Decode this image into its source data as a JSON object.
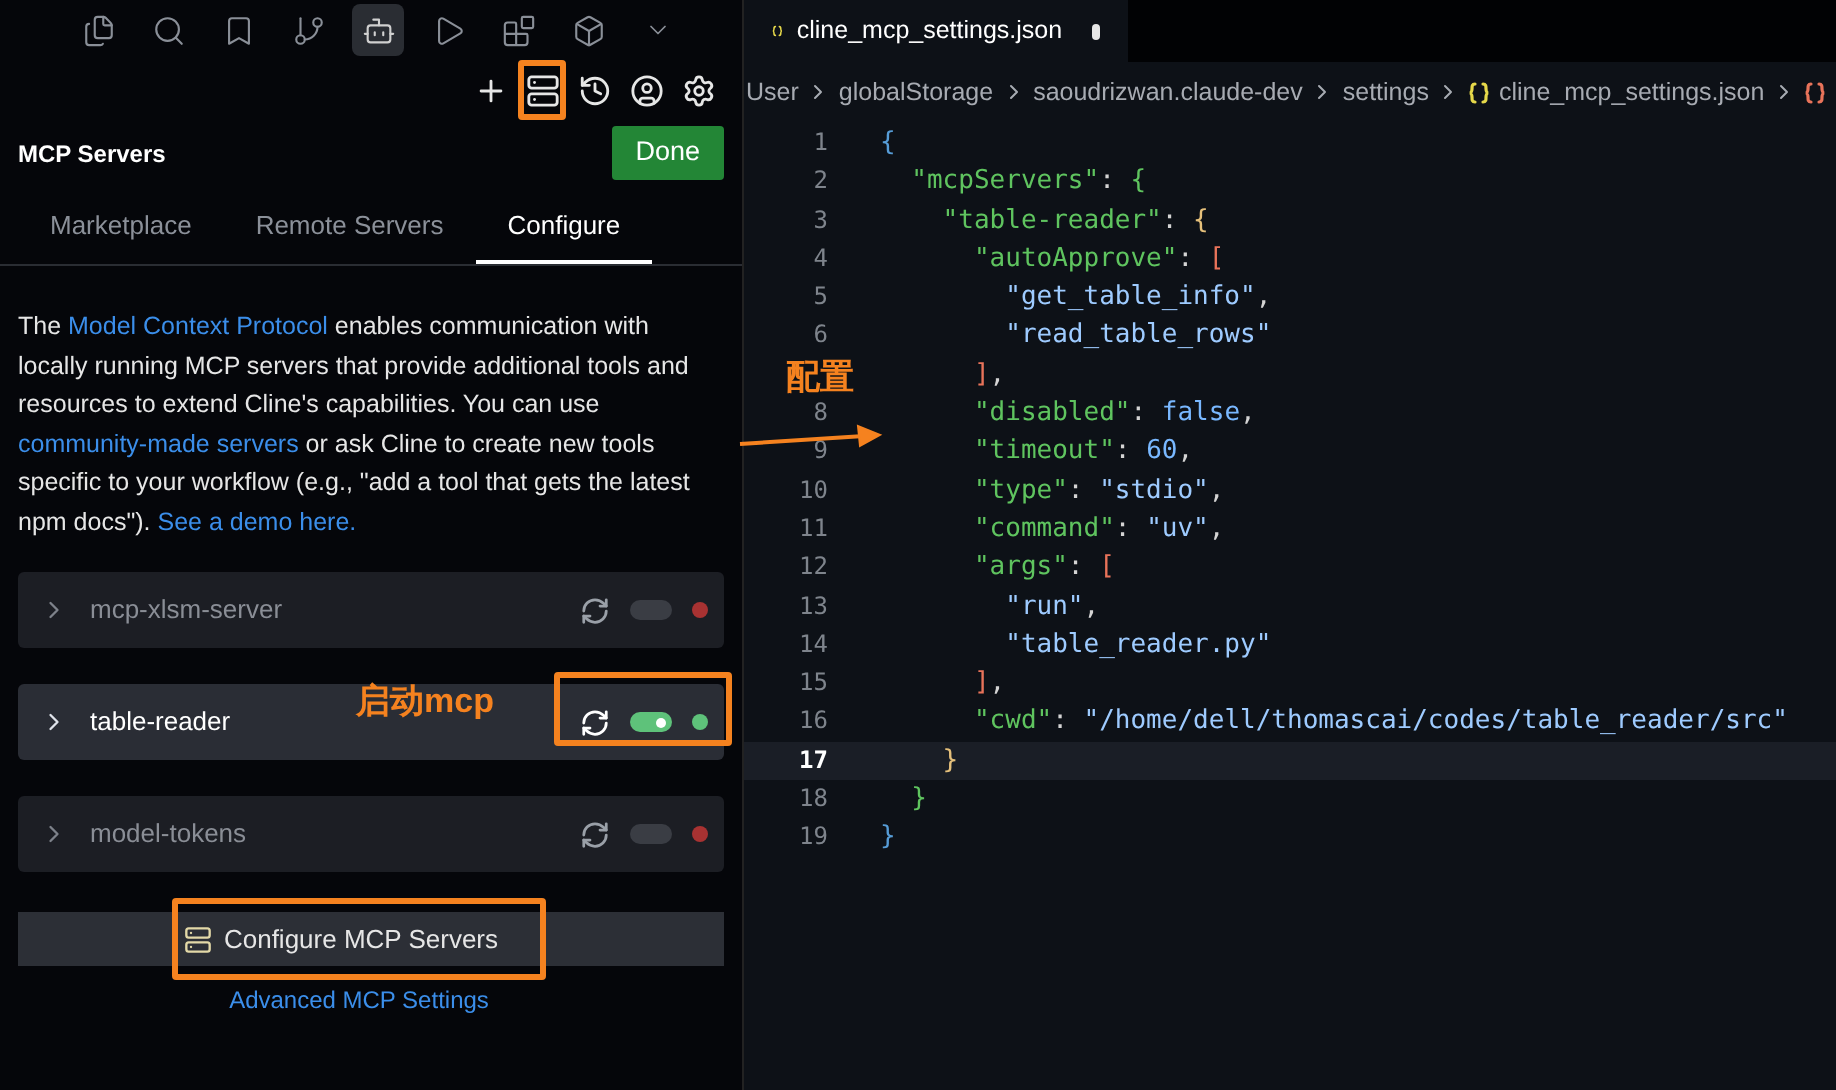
{
  "activity_bar": [
    {
      "kind": "files",
      "selected": false
    },
    {
      "kind": "search",
      "selected": false
    },
    {
      "kind": "bookmark",
      "selected": false
    },
    {
      "kind": "branch",
      "selected": false
    },
    {
      "kind": "robot",
      "selected": true
    },
    {
      "kind": "run",
      "selected": false
    },
    {
      "kind": "blocks",
      "selected": false
    },
    {
      "kind": "cube",
      "selected": false
    },
    {
      "kind": "more",
      "selected": false
    }
  ],
  "toolbar": [
    {
      "kind": "plus",
      "highlighted": false
    },
    {
      "kind": "servers",
      "highlighted": true
    },
    {
      "kind": "history",
      "highlighted": false
    },
    {
      "kind": "account",
      "highlighted": false
    },
    {
      "kind": "settings",
      "highlighted": false
    }
  ],
  "header": {
    "title": "MCP Servers",
    "done_button": "Done"
  },
  "tabs": [
    {
      "label": "Marketplace",
      "selected": false
    },
    {
      "label": "Remote Servers",
      "selected": false
    },
    {
      "label": "Configure",
      "selected": true
    }
  ],
  "description": [
    {
      "text": "The ",
      "link": false
    },
    {
      "text": "Model Context Protocol",
      "link": true
    },
    {
      "text": " enables communication with locally running MCP servers that provide additional tools and resources to extend Cline's capabilities. You can use ",
      "link": false
    },
    {
      "text": "community-made servers",
      "link": true
    },
    {
      "text": " or ask Cline to create new tools specific to your workflow (e.g., \"add a tool that gets the latest npm docs\"). ",
      "link": false
    },
    {
      "text": "See a demo here.",
      "link": true
    }
  ],
  "servers": [
    {
      "name": "mcp-xlsm-server",
      "enabled": false,
      "color": "#a83232",
      "highlighted": false
    },
    {
      "name": "table-reader",
      "enabled": true,
      "color": "#5ec27a",
      "highlighted": true
    },
    {
      "name": "model-tokens",
      "enabled": false,
      "color": "#a83232",
      "highlighted": false
    }
  ],
  "configure_button": {
    "label": "Configure MCP Servers",
    "highlighted": true
  },
  "advanced_link": "Advanced MCP Settings",
  "editor": {
    "tab": {
      "title": "cline_mcp_settings.json",
      "modified": true
    },
    "breadcrumbs": [
      {
        "text": "User",
        "kind": "folder"
      },
      {
        "text": "globalStorage",
        "kind": "folder"
      },
      {
        "text": "saoudrizwan.claude-dev",
        "kind": "folder"
      },
      {
        "text": "settings",
        "kind": "folder"
      },
      {
        "text": "cline_mcp_settings.json",
        "kind": "file"
      },
      {
        "kind": "object"
      }
    ],
    "lines": [
      {
        "number": "1",
        "current": false,
        "tokens": [
          {
            "kind": "brace1",
            "text": "{"
          }
        ]
      },
      {
        "number": "2",
        "current": false,
        "tokens": [
          {
            "kind": "key",
            "text": "  \"mcpServers\""
          },
          {
            "kind": "punct",
            "text": ": "
          },
          {
            "kind": "brace2",
            "text": "{"
          }
        ]
      },
      {
        "number": "3",
        "current": false,
        "tokens": [
          {
            "kind": "key",
            "text": "    \"table-reader\""
          },
          {
            "kind": "punct",
            "text": ": "
          },
          {
            "kind": "brace3",
            "text": "{"
          }
        ]
      },
      {
        "number": "4",
        "current": false,
        "tokens": [
          {
            "kind": "key",
            "text": "      \"autoApprove\""
          },
          {
            "kind": "punct",
            "text": ": "
          },
          {
            "kind": "bracket",
            "text": "["
          }
        ]
      },
      {
        "number": "5",
        "current": false,
        "tokens": [
          {
            "kind": "string",
            "text": "        \"get_table_info\""
          },
          {
            "kind": "punct",
            "text": ","
          }
        ]
      },
      {
        "number": "6",
        "current": false,
        "tokens": [
          {
            "kind": "string",
            "text": "        \"read_table_rows\""
          }
        ]
      },
      {
        "current": false,
        "tokens": [
          {
            "kind": "bracket",
            "text": "      ]"
          },
          {
            "kind": "punct",
            "text": ","
          }
        ]
      },
      {
        "number": "8",
        "current": false,
        "tokens": [
          {
            "kind": "key",
            "text": "      \"disabled\""
          },
          {
            "kind": "punct",
            "text": ": "
          },
          {
            "kind": "number",
            "text": "false"
          },
          {
            "kind": "punct",
            "text": ","
          }
        ]
      },
      {
        "number": "9",
        "current": false,
        "tokens": [
          {
            "kind": "key",
            "text": "      \"timeout\""
          },
          {
            "kind": "punct",
            "text": ": "
          },
          {
            "kind": "number",
            "text": "60"
          },
          {
            "kind": "punct",
            "text": ","
          }
        ]
      },
      {
        "number": "10",
        "current": false,
        "tokens": [
          {
            "kind": "key",
            "text": "      \"type\""
          },
          {
            "kind": "punct",
            "text": ": "
          },
          {
            "kind": "string",
            "text": "\"stdio\""
          },
          {
            "kind": "punct",
            "text": ","
          }
        ]
      },
      {
        "number": "11",
        "current": false,
        "tokens": [
          {
            "kind": "key",
            "text": "      \"command\""
          },
          {
            "kind": "punct",
            "text": ": "
          },
          {
            "kind": "string",
            "text": "\"uv\""
          },
          {
            "kind": "punct",
            "text": ","
          }
        ]
      },
      {
        "number": "12",
        "current": false,
        "tokens": [
          {
            "kind": "key",
            "text": "      \"args\""
          },
          {
            "kind": "punct",
            "text": ": "
          },
          {
            "kind": "bracket",
            "text": "["
          }
        ]
      },
      {
        "number": "13",
        "current": false,
        "tokens": [
          {
            "kind": "string",
            "text": "        \"run\""
          },
          {
            "kind": "punct",
            "text": ","
          }
        ]
      },
      {
        "number": "14",
        "current": false,
        "tokens": [
          {
            "kind": "string",
            "text": "        \"table_reader.py\""
          }
        ]
      },
      {
        "number": "15",
        "current": false,
        "tokens": [
          {
            "kind": "bracket",
            "text": "      ]"
          },
          {
            "kind": "punct",
            "text": ","
          }
        ]
      },
      {
        "number": "16",
        "current": false,
        "tokens": [
          {
            "kind": "key",
            "text": "      \"cwd\""
          },
          {
            "kind": "punct",
            "text": ": "
          },
          {
            "kind": "string",
            "text": "\"/home/dell/thomascai/codes/table_reader/src\""
          }
        ]
      },
      {
        "number": "17",
        "current": true,
        "tokens": [
          {
            "kind": "brace3",
            "text": "    }"
          }
        ]
      },
      {
        "number": "18",
        "current": false,
        "tokens": [
          {
            "kind": "brace2",
            "text": "  }"
          }
        ]
      },
      {
        "number": "19",
        "current": false,
        "tokens": [
          {
            "kind": "brace1",
            "text": "}"
          }
        ]
      }
    ]
  },
  "annotations": [
    {
      "kind": "config",
      "text": "配置"
    },
    {
      "kind": "start",
      "text": "启动mcp"
    }
  ]
}
